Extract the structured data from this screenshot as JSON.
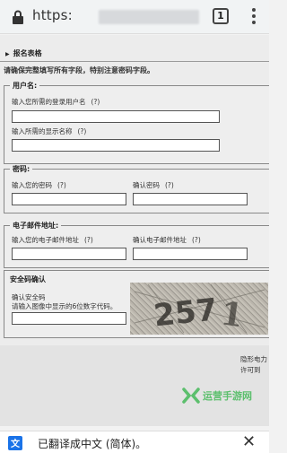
{
  "browser": {
    "url": "https:",
    "tab_count": "1"
  },
  "page": {
    "section_title": "报名表格",
    "instruction": "请确保完整填写所有字段，特别注意密码字段。",
    "username_group": {
      "legend": "用户名:",
      "login_label": "输入您所需的登录用户名",
      "display_label": "输入所需的显示名称",
      "help": "(?)"
    },
    "password_group": {
      "legend": "密码:",
      "password_label": "输入您的密码",
      "confirm_label": "确认密码",
      "help": "(?)"
    },
    "email_group": {
      "legend": "电子邮件地址:",
      "email_label": "输入您的电子邮件地址",
      "confirm_label": "确认电子邮件地址",
      "help": "(?)"
    },
    "captcha_group": {
      "legend": "安全码确认",
      "label_line1": "确认安全码",
      "label_line2": "请输入图像中显示的6位数字代码。"
    },
    "side_note": [
      "隐形电力",
      "许可到"
    ]
  },
  "watermark": {
    "text": "运营手游网"
  },
  "translate_bar": {
    "message": "已翻译成中文 (简体)。"
  }
}
